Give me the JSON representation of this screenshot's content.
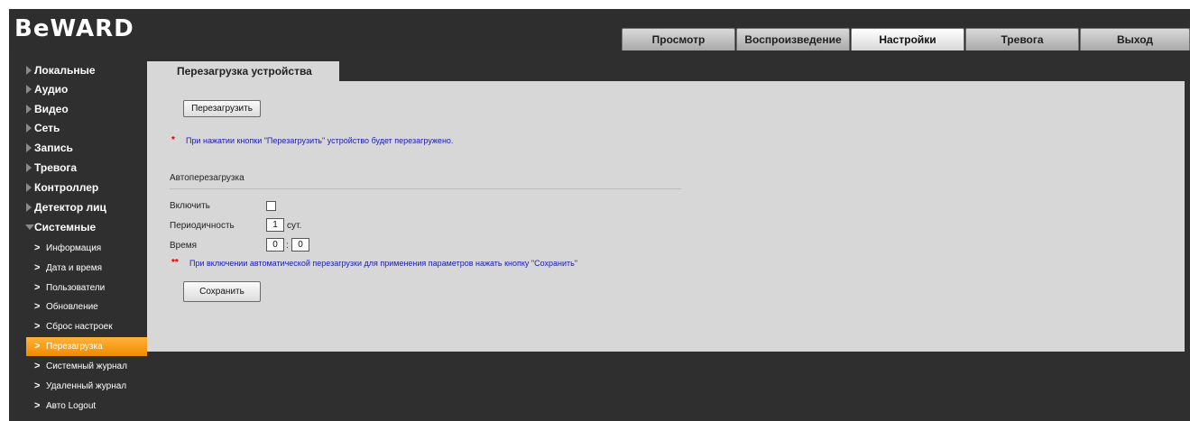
{
  "header": {
    "logo": "BeWARD",
    "tabs": [
      {
        "label": "Просмотр",
        "active": false
      },
      {
        "label": "Воспроизведение",
        "active": false
      },
      {
        "label": "Настройки",
        "active": true
      },
      {
        "label": "Тревога",
        "active": false
      },
      {
        "label": "Выход",
        "active": false
      }
    ]
  },
  "sidebar": {
    "items": [
      {
        "label": "Локальные"
      },
      {
        "label": "Аудио"
      },
      {
        "label": "Видео"
      },
      {
        "label": "Сеть"
      },
      {
        "label": "Запись"
      },
      {
        "label": "Тревога"
      },
      {
        "label": "Контроллер"
      },
      {
        "label": "Детектор лиц"
      },
      {
        "label": "Системные",
        "expanded": true
      }
    ],
    "subitems": [
      {
        "label": "Информация"
      },
      {
        "label": "Дата и время"
      },
      {
        "label": "Пользователи"
      },
      {
        "label": "Обновление"
      },
      {
        "label": "Сброс настроек"
      },
      {
        "label": "Перезагрузка",
        "active": true
      },
      {
        "label": "Системный журнал"
      },
      {
        "label": "Удаленный журнал"
      },
      {
        "label": "Авто Logout"
      }
    ],
    "active_color": "#f59a12"
  },
  "main": {
    "page_tab": "Перезагрузка устройства",
    "reboot_button": "Перезагрузить",
    "reboot_note_marker": "*",
    "reboot_note": "При нажатии кнопки \"Перезагрузить\" устройство будет перезагружено.",
    "auto_section_title": "Автоперезагрузка",
    "enable_label": "Включить",
    "enable_checked": false,
    "period_label": "Периодичность",
    "period_value": "1",
    "period_unit": "сут.",
    "time_label": "Время",
    "time_hours": "0",
    "time_separator": ":",
    "time_minutes": "0",
    "auto_note_marker": "**",
    "auto_note": "При включении автоматической перезагрузки для применения параметров нажать кнопку \"Сохранить\"",
    "save_button": "Сохранить"
  }
}
